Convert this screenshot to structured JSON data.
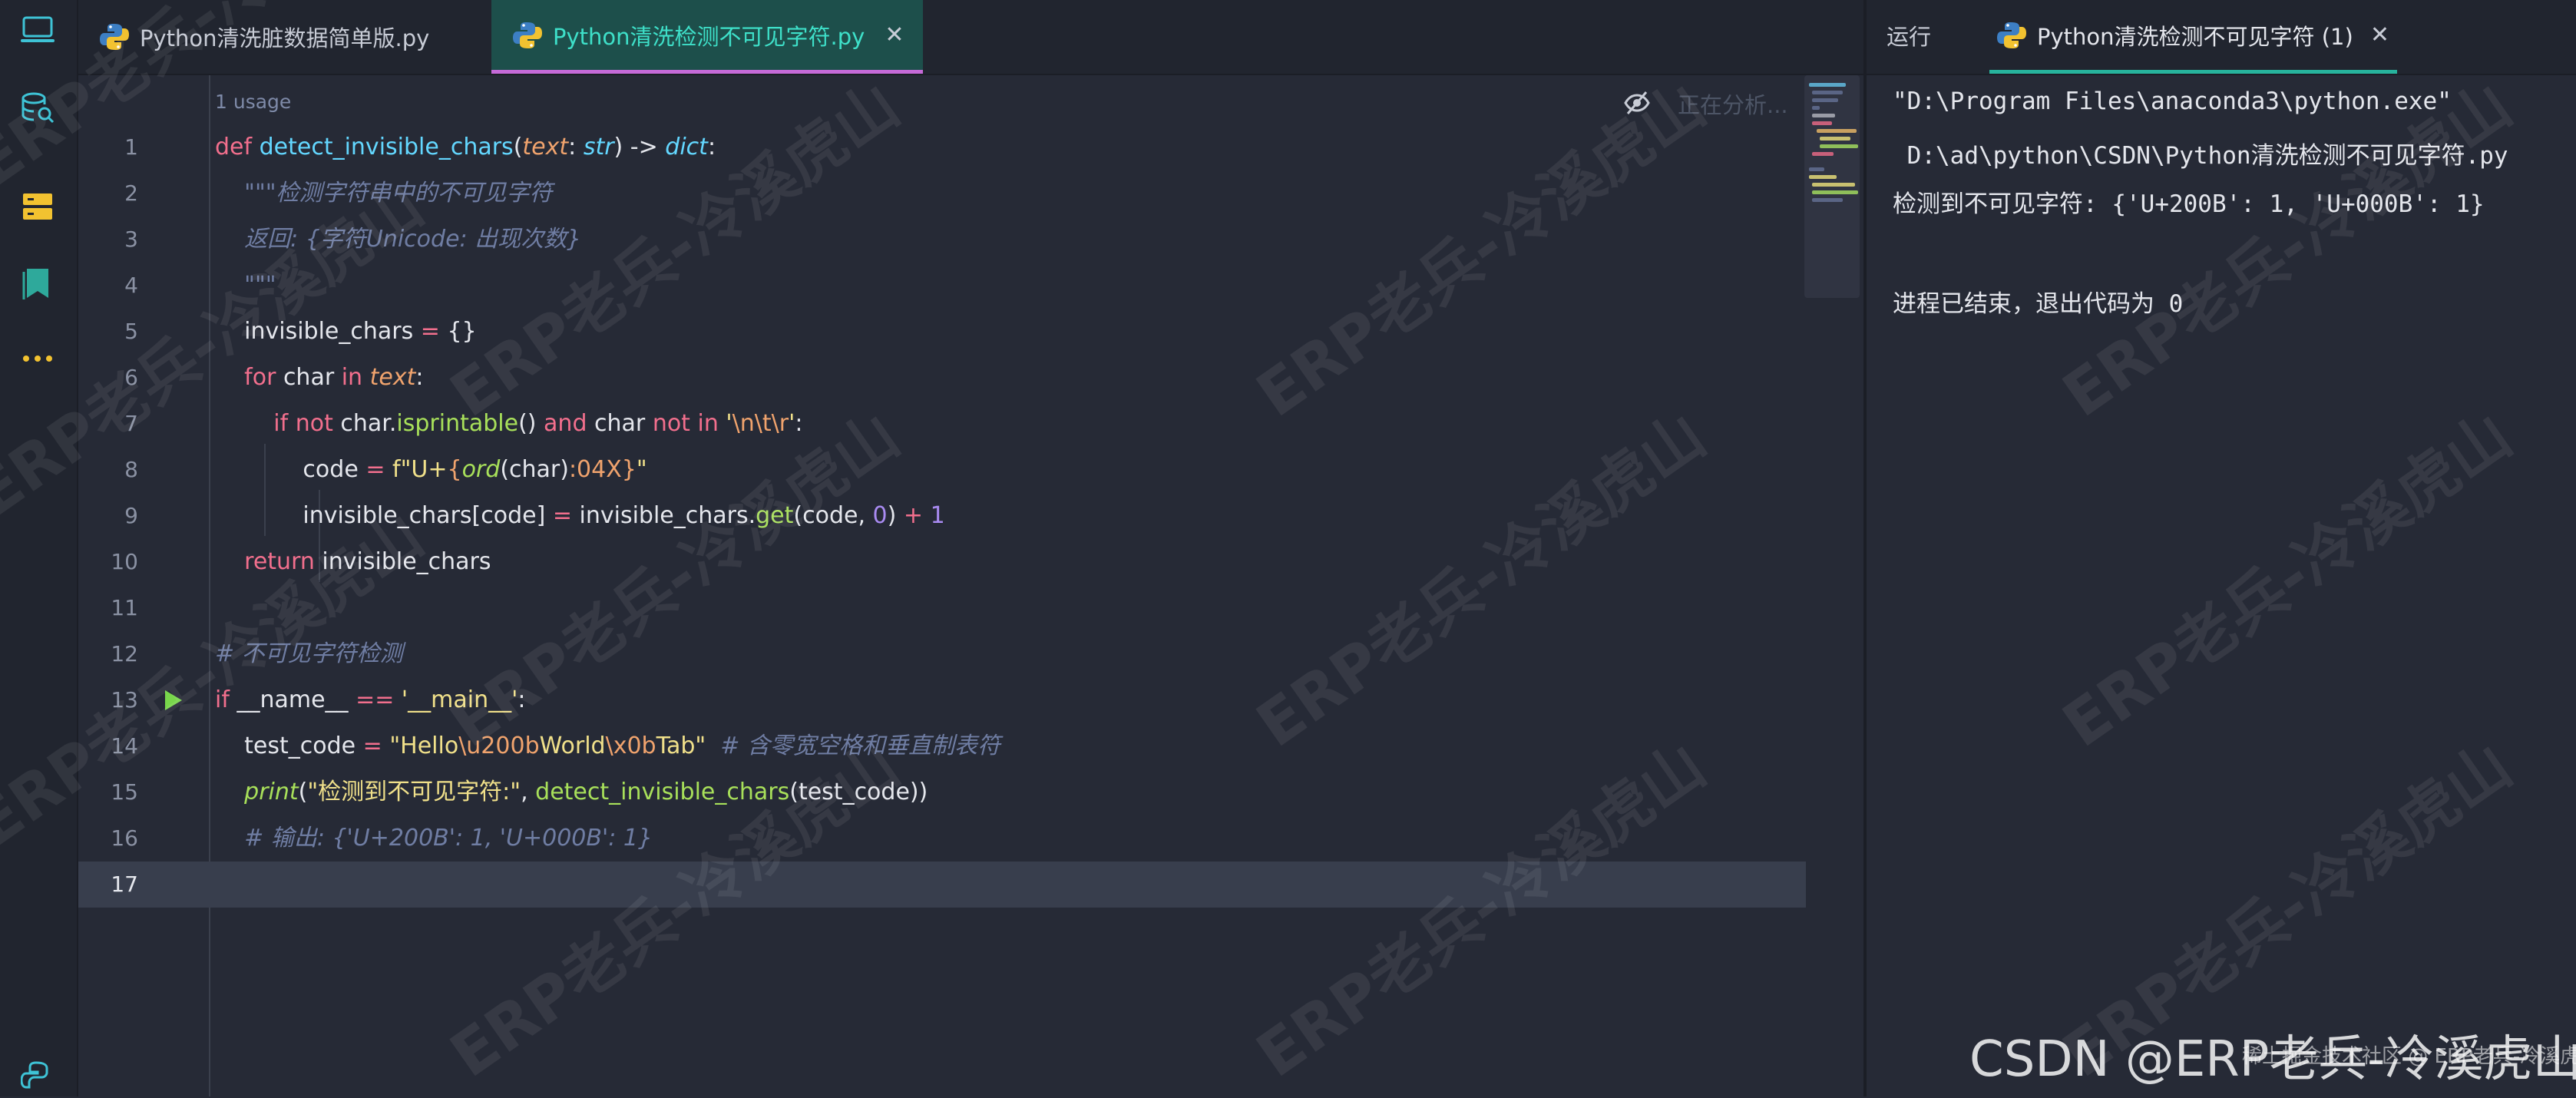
{
  "tabs": [
    {
      "label": "Python清洗脏数据简单版.py",
      "active": false
    },
    {
      "label": "Python清洗检测不可见字符.py",
      "active": true
    }
  ],
  "editor": {
    "usage_hint": "1 usage",
    "analyzing": "正在分析...",
    "line_numbers": [
      "1",
      "2",
      "3",
      "4",
      "5",
      "6",
      "7",
      "8",
      "9",
      "10",
      "11",
      "12",
      "13",
      "14",
      "15",
      "16",
      "17"
    ],
    "current_line": 17
  },
  "run_panel": {
    "label": "运行",
    "tab_label": "Python清洗检测不可见字符 (1)",
    "console": [
      "\"D:\\Program Files\\anaconda3\\python.exe\"",
      " D:\\ad\\python\\CSDN\\Python清洗检测不可见字符.py",
      "检测到不可见字符: {'U+200B': 1, 'U+000B': 1}",
      "",
      "进程已结束，退出代码为 0"
    ]
  },
  "watermark": {
    "text": "ERP老兵-冷溪虎山",
    "credit": "CSDN @ERP老兵-冷溪虎山",
    "credit_small": "稀土掘金技术社区 @ ERP老兵-冷溪虎山"
  },
  "colors": {
    "background": "#262a36",
    "active_tab_bg": "#1d4f4b",
    "active_tab_text": "#3ee0c9",
    "keyword": "#f26f8d",
    "function": "#63d7ff",
    "string": "#f0e08a",
    "comment": "#6f7da3",
    "number": "#a98bf2"
  }
}
